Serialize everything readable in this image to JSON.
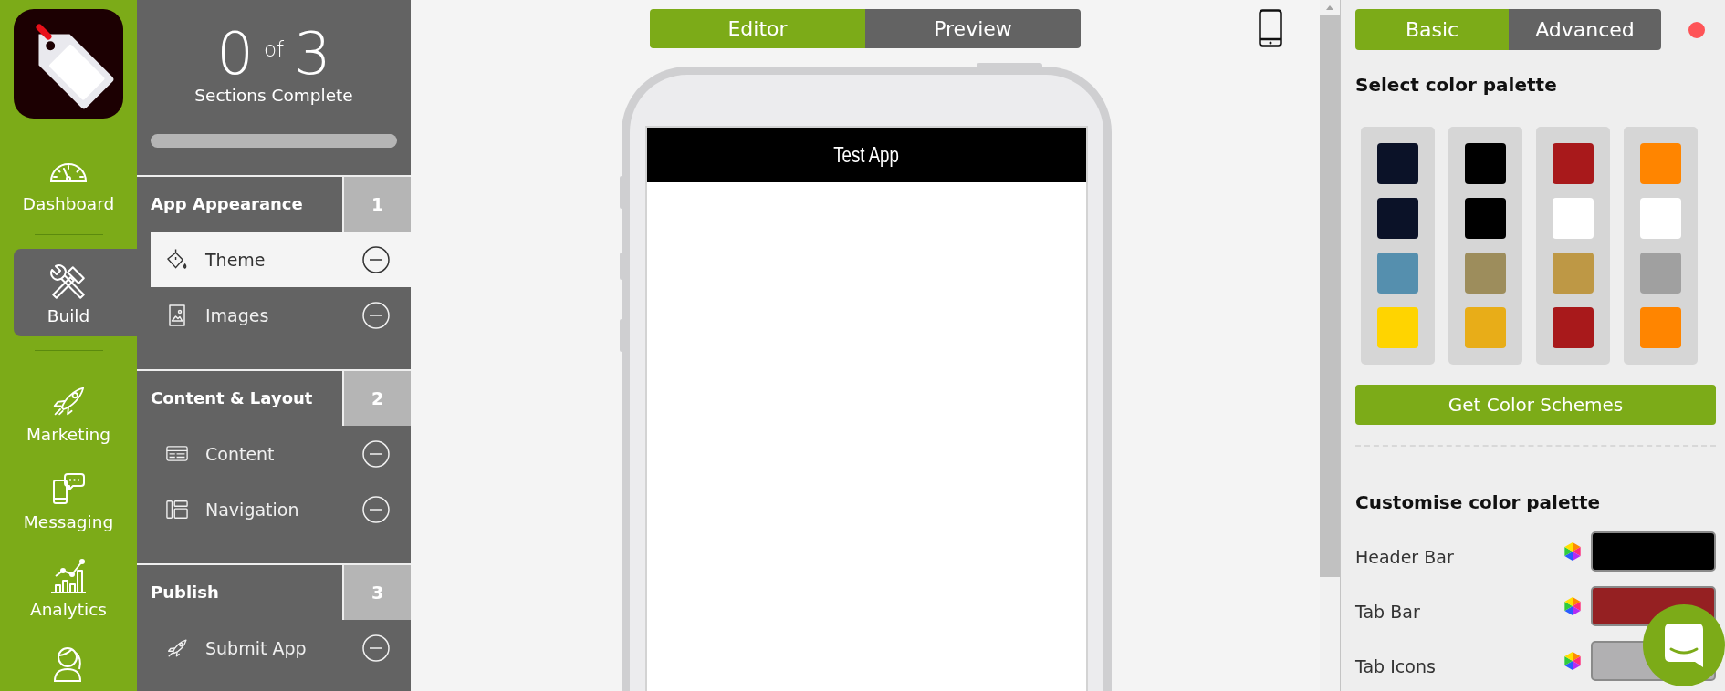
{
  "nav": {
    "items": [
      {
        "label": "Dashboard",
        "selected": false
      },
      {
        "label": "Build",
        "selected": true
      },
      {
        "label": "Marketing",
        "selected": false
      },
      {
        "label": "Messaging",
        "selected": false
      },
      {
        "label": "Analytics",
        "selected": false
      },
      {
        "selected": false
      }
    ]
  },
  "progress": {
    "completed": "0",
    "separator": "of",
    "total": "3",
    "caption": "Sections Complete",
    "level": 0
  },
  "sections": [
    {
      "title": "App Appearance",
      "number": "1",
      "items": [
        {
          "label": "Theme",
          "selected": true
        },
        {
          "label": "Images",
          "selected": false
        }
      ]
    },
    {
      "title": "Content & Layout",
      "number": "2",
      "items": [
        {
          "label": "Content",
          "selected": false
        },
        {
          "label": "Navigation",
          "selected": false
        }
      ]
    },
    {
      "title": "Publish",
      "number": "3",
      "items": [
        {
          "label": "Submit App",
          "selected": false
        }
      ]
    }
  ],
  "view_tabs": [
    {
      "label": "Editor",
      "selected": true
    },
    {
      "label": "Preview",
      "selected": false
    }
  ],
  "preview": {
    "app_title": "Test App"
  },
  "panel_tabs": [
    {
      "label": "Basic",
      "selected": true
    },
    {
      "label": "Advanced",
      "selected": false
    }
  ],
  "palette_heading": "Select color palette",
  "palettes": [
    {
      "swatches": [
        {
          "color": "#0b1228"
        },
        {
          "color": "#0b1228"
        },
        {
          "color": "#558fae"
        },
        {
          "color": "#ffd400"
        }
      ]
    },
    {
      "swatches": [
        {
          "color": "#000000"
        },
        {
          "color": "#000000"
        },
        {
          "color": "#9d8d5c"
        },
        {
          "color": "#e8ad18"
        }
      ]
    },
    {
      "swatches": [
        {
          "color": "#a8191b"
        },
        {
          "color": "#ffffff"
        },
        {
          "color": "#be9845"
        },
        {
          "color": "#a8191b"
        }
      ]
    },
    {
      "swatches": [
        {
          "color": "#ff8500"
        },
        {
          "color": "#ffffff"
        },
        {
          "color": "#a0a0a0"
        },
        {
          "color": "#ff8500"
        }
      ]
    }
  ],
  "schemes_button": "Get Color Schemes",
  "customise": {
    "heading": "Customise color palette",
    "rows": [
      {
        "label": "Header Bar",
        "color": "#000000"
      },
      {
        "label": "Tab Bar",
        "color": "#952022"
      },
      {
        "label": "Tab Icons",
        "color": "#b1b0b2"
      }
    ]
  }
}
